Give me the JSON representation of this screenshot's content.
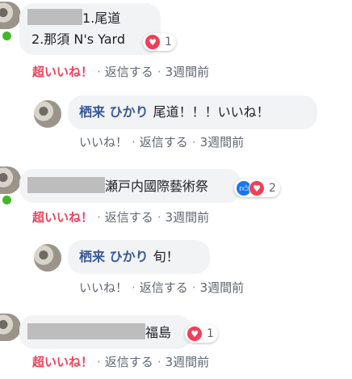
{
  "comments": [
    {
      "lines": [
        "1.尾道",
        "2.那須 N's Yard"
      ],
      "reaction_count": "1",
      "actions": {
        "super_like": "超いいね！",
        "reply": "返信する",
        "time": "3週間前"
      }
    },
    {
      "author": "栖来 ひかり",
      "text": "尾道！！！いいね！",
      "actions": {
        "like": "いいね！",
        "reply": "返信する",
        "time": "3週間前"
      }
    },
    {
      "text": "瀬戸内國際藝術祭",
      "reaction_count": "2",
      "actions": {
        "super_like": "超いいね！",
        "reply": "返信する",
        "time": "3週間前"
      }
    },
    {
      "author": "栖来 ひかり",
      "text": "旬！",
      "actions": {
        "like": "いいね！",
        "reply": "返信する",
        "time": "3週間前"
      }
    },
    {
      "text": "福島",
      "reaction_count": "1",
      "actions": {
        "super_like": "超いいね！",
        "reply": "返信する",
        "time": "3週間前"
      }
    }
  ],
  "separator": "·",
  "icons": {
    "love": "heart-icon",
    "like": "thumbs-up-icon"
  },
  "colors": {
    "author": "#385898",
    "super_like": "#f33e58",
    "like_blue": "#1877f2",
    "online": "#42b72a",
    "bubble": "#f2f3f5"
  }
}
